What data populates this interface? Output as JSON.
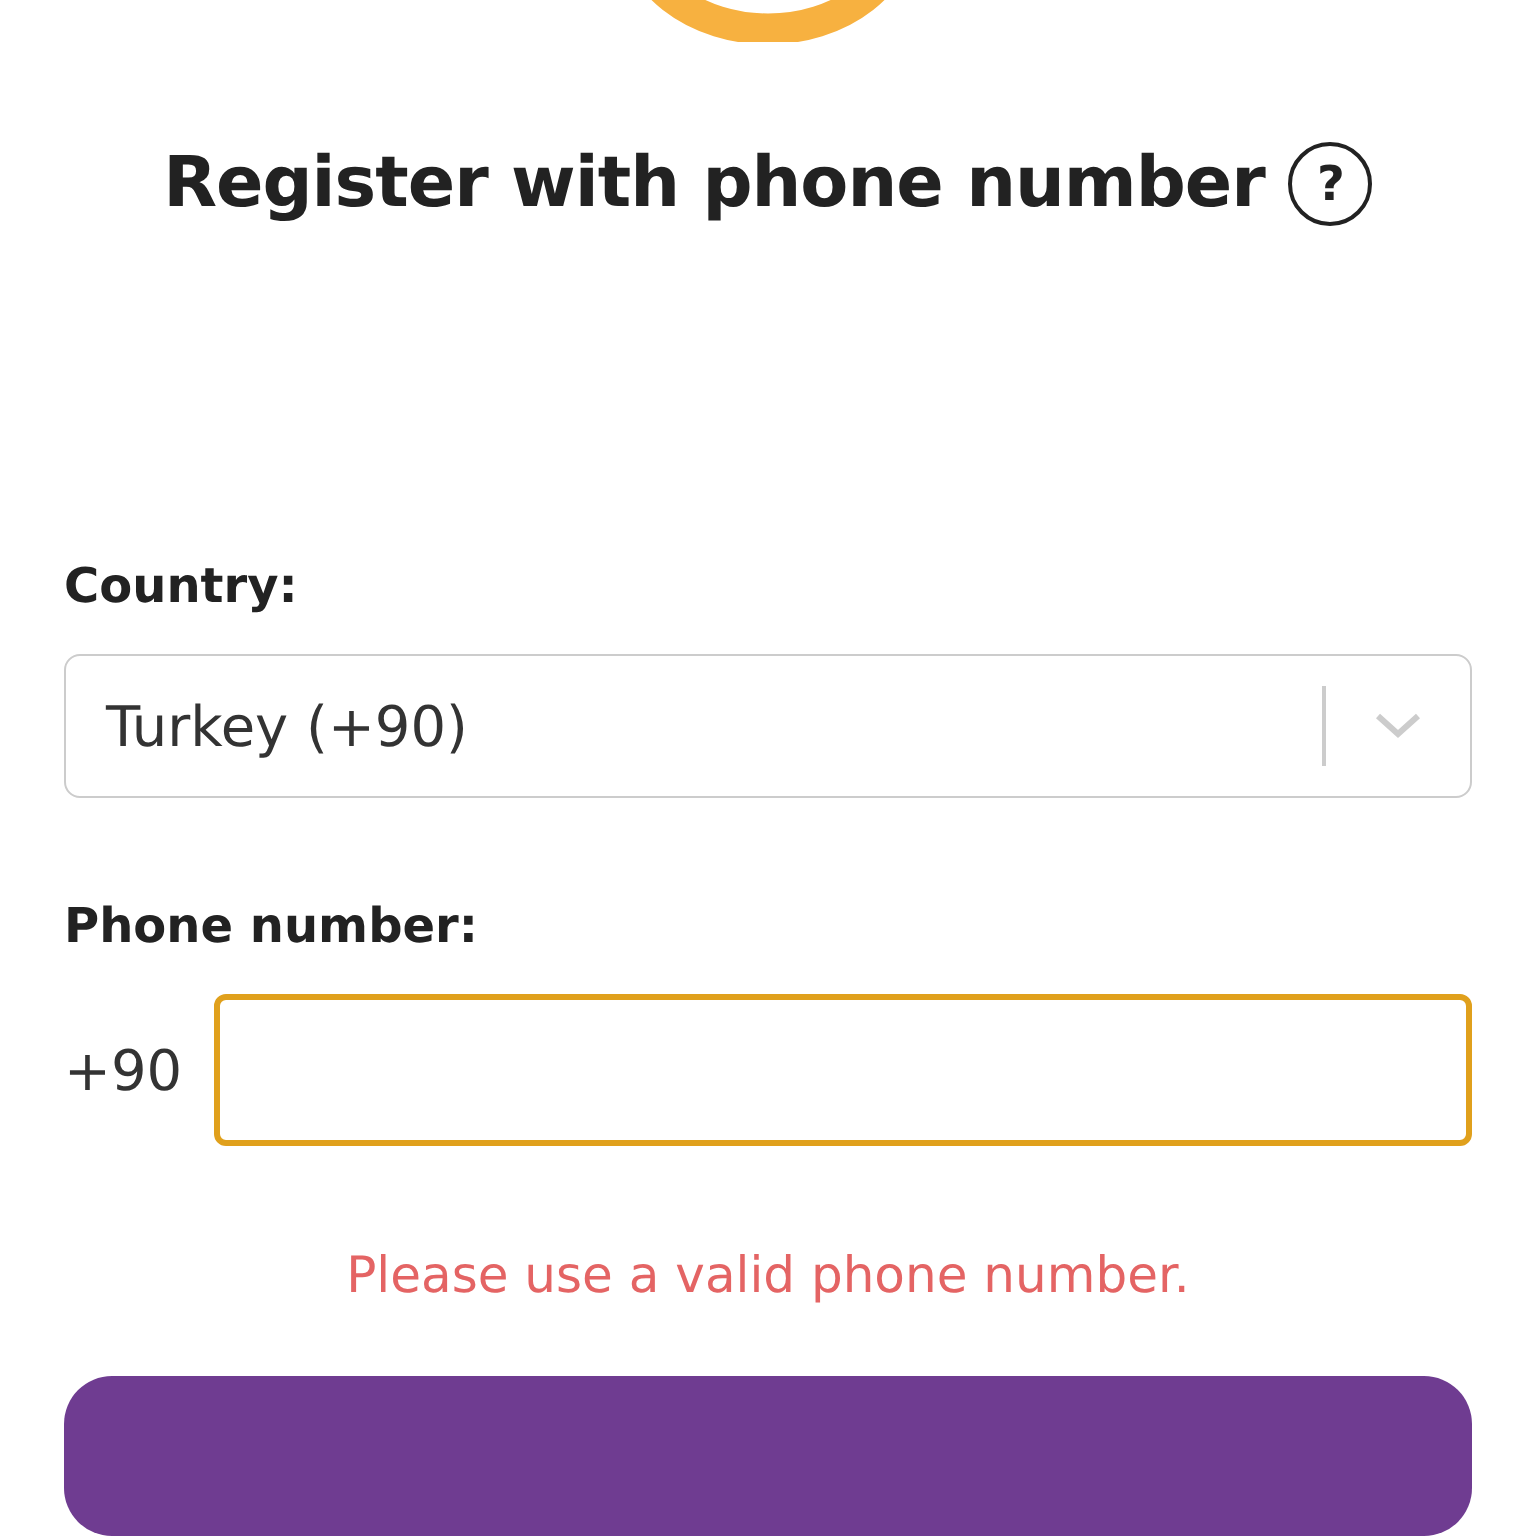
{
  "title": "Register with phone number",
  "help_icon": "?",
  "country": {
    "label": "Country:",
    "value": "Turkey (+90)"
  },
  "phone": {
    "label": "Phone number:",
    "prefix": "+90",
    "invalid": true,
    "error": "Please use a valid phone number."
  }
}
